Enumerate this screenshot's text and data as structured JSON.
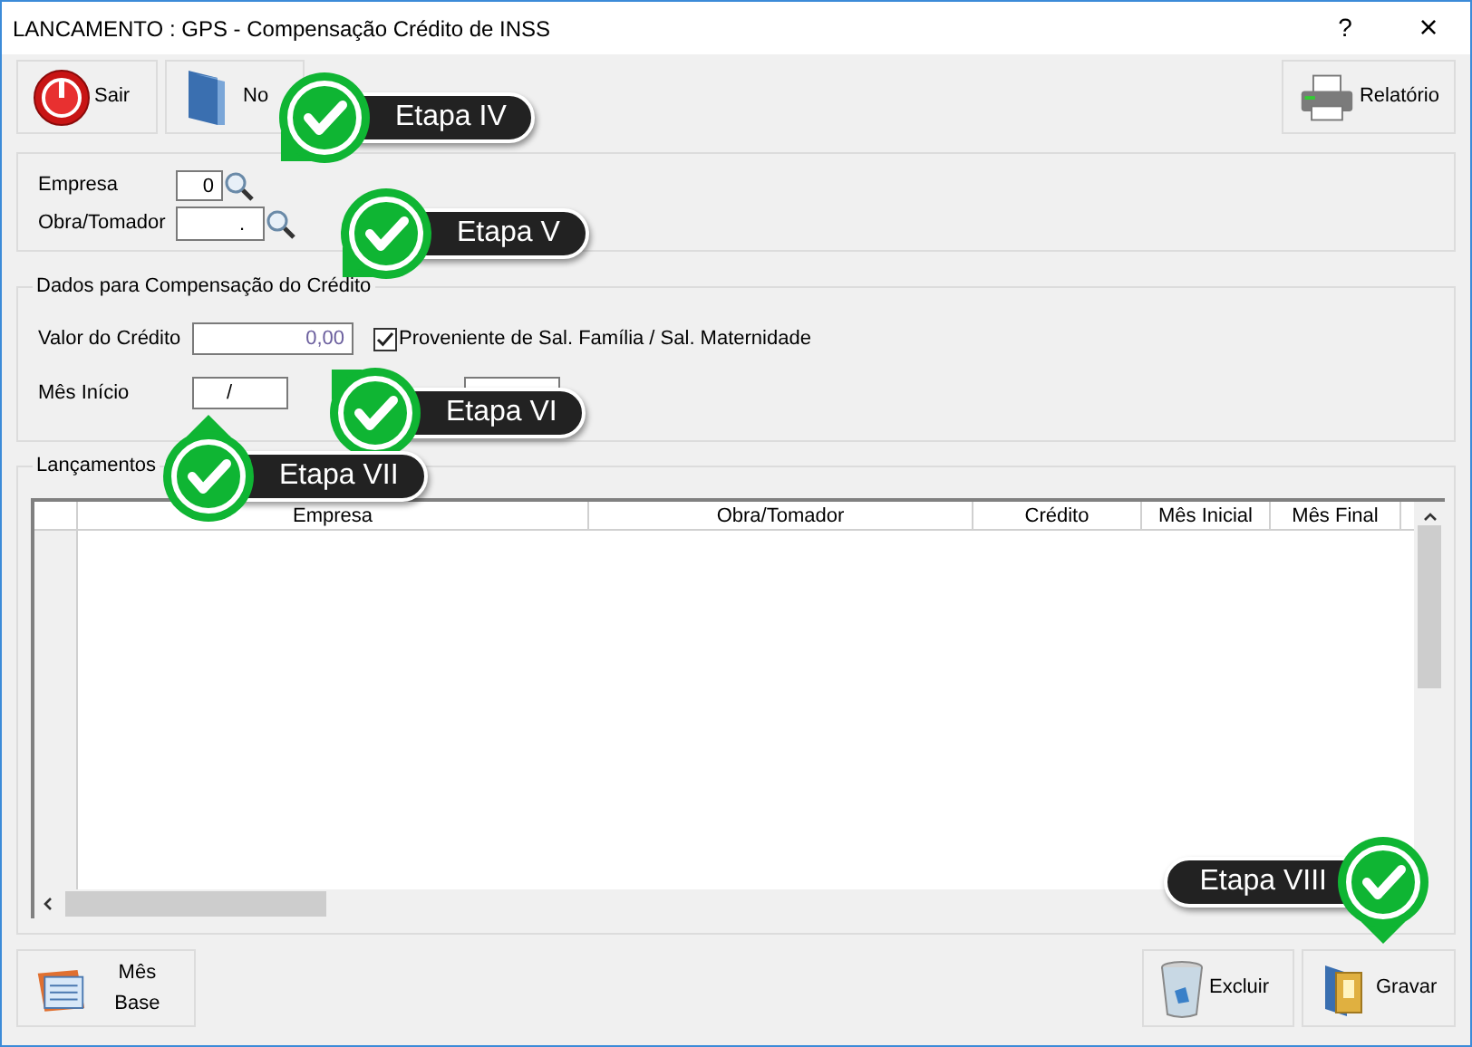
{
  "window": {
    "title": "LANCAMENTO : GPS - Compensação Crédito de INSS",
    "help": "?",
    "close": "×"
  },
  "toolbar": [
    {
      "kind": "power",
      "label": "Sair"
    },
    {
      "kind": "folder",
      "label": "No"
    },
    {
      "kind": "printer",
      "label": "Relatório"
    }
  ],
  "filter": {
    "empresa_label": "Empresa",
    "empresa_value": "0",
    "obra_label": "Obra/Tomador",
    "obra_value": "."
  },
  "credit": {
    "title": "Dados para Compensação do Crédito",
    "valor_label": "Valor do Crédito",
    "valor_value": "0,00",
    "checkbox_label": "Proveniente de Sal. Família / Sal. Maternidade",
    "checked": true,
    "inicio_label": "Mês Início",
    "inicio_value": "/"
  },
  "lancamentos": {
    "title": "Lançamentos",
    "columns": [
      "Empresa",
      "Obra/Tomador",
      "Crédito",
      "Mês Inicial",
      "Mês Final"
    ]
  },
  "bottom": [
    {
      "kind": "calendar",
      "label": "Mês Base"
    },
    {
      "kind": "trash",
      "label": "Excluir"
    },
    {
      "kind": "save",
      "label": "Gravar"
    }
  ],
  "callouts": [
    {
      "label": "Etapa IV"
    },
    {
      "label": "Etapa V"
    },
    {
      "label": "Etapa VI"
    },
    {
      "label": "Etapa VII"
    },
    {
      "label": "Etapa VIII"
    }
  ]
}
